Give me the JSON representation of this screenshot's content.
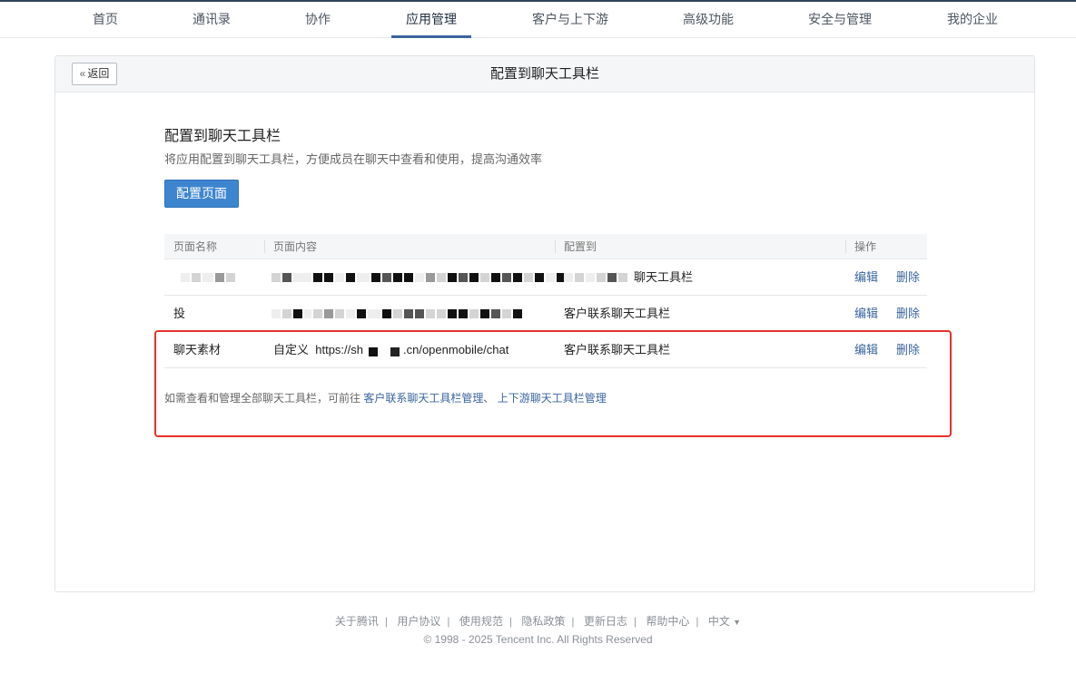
{
  "nav": {
    "items": [
      {
        "label": "首页"
      },
      {
        "label": "通讯录"
      },
      {
        "label": "协作"
      },
      {
        "label": "应用管理"
      },
      {
        "label": "客户与上下游"
      },
      {
        "label": "高级功能"
      },
      {
        "label": "安全与管理"
      },
      {
        "label": "我的企业"
      }
    ],
    "active": "应用管理"
  },
  "panel": {
    "back_label": "返回",
    "back_icon": "double-chevron-left",
    "title": "配置到聊天工具栏"
  },
  "section": {
    "title": "配置到聊天工具栏",
    "description": "将应用配置到聊天工具栏，方便成员在聊天中查看和使用，提高沟通效率",
    "config_button": "配置页面"
  },
  "table": {
    "headers": [
      "页面名称",
      "页面内容",
      "配置到",
      "操作"
    ],
    "rows": [
      {
        "name": "",
        "content": "",
        "target": "聊天工具栏",
        "edit": "编辑",
        "delete": "删除"
      },
      {
        "name": "投",
        "content": "",
        "target": "客户联系聊天工具栏",
        "edit": "编辑",
        "delete": "删除"
      },
      {
        "name": "聊天素材",
        "content_prefix": "自定义",
        "content_url_start": "https://sh",
        "content_url_end": ".cn/openmobile/chat",
        "target": "客户联系聊天工具栏",
        "edit": "编辑",
        "delete": "删除"
      }
    ]
  },
  "footnote": {
    "text": "如需查看和管理全部聊天工具栏，可前往",
    "link1": "客户联系聊天工具栏管理",
    "sep": "、",
    "link2": "上下游聊天工具栏管理"
  },
  "footer": {
    "links": [
      "关于腾讯",
      "用户协议",
      "使用规范",
      "隐私政策",
      "更新日志",
      "帮助中心"
    ],
    "language": "中文",
    "copyright": "© 1998 - 2025 Tencent Inc. All Rights Reserved"
  },
  "colors": {
    "accent": "#3a64a0",
    "primary_button": "#3d85cf",
    "highlight": "#e8312c"
  }
}
